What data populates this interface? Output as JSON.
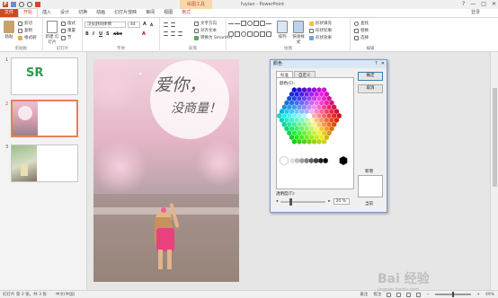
{
  "titlebar": {
    "app_icon": "P",
    "context_tools_label": "绘图工具",
    "window_title": "fuyian - PowerPoint",
    "controls": [
      "?",
      "—",
      "□",
      "✕"
    ]
  },
  "tabs": {
    "items": [
      "文件",
      "开始",
      "插入",
      "设计",
      "切换",
      "动画",
      "幻灯片放映",
      "审阅",
      "视图",
      "格式"
    ],
    "user": "登录"
  },
  "ribbon": {
    "paste_label": "粘贴",
    "cut_label": "剪切",
    "copy_label": "复制",
    "format_painter_label": "格式刷",
    "new_slide_label": "新建\n幻灯片",
    "layout_label": "版式",
    "reset_label": "重置",
    "section_label": "节",
    "font_name": "汉仪舒同体简",
    "font_size": "44",
    "text_direction_label": "文字方向",
    "align_text_label": "对齐文本",
    "smartart_label": "转换为 SmartArt",
    "arrange_label": "排列",
    "quick_styles_label": "快速样式",
    "shape_fill_label": "形状填充",
    "shape_outline_label": "形状轮廓",
    "shape_effects_label": "形状效果",
    "find_label": "查找",
    "replace_label": "替换",
    "select_label": "选择",
    "groups": [
      "剪贴板",
      "幻灯片",
      "字体",
      "段落",
      "绘图",
      "编辑"
    ]
  },
  "thumbnails": [
    {
      "number": "1",
      "logo_text": "SR"
    },
    {
      "number": "2",
      "caption": "爱你，没商量！"
    },
    {
      "number": "3"
    }
  ],
  "slide": {
    "title_line1": "爱你，",
    "title_line2": "没商量！"
  },
  "dialog": {
    "title": "颜色",
    "tabs": [
      "标准",
      "自定义"
    ],
    "colors_label": "颜色(C):",
    "ok_label": "确定",
    "cancel_label": "取消",
    "new_label": "新增",
    "current_label": "当前",
    "transparency_label": "透明度(T):",
    "transparency_value": "20 %",
    "transparency_fraction": 0.2
  },
  "statusbar": {
    "slide_info": "幻灯片 第 2 张，共 3 张",
    "language": "中文(中国)",
    "notes_label": "备注",
    "comments_label": "批注",
    "zoom": "49%"
  },
  "watermark": {
    "text": "Bai 经验",
    "sub": "jingyan.baidu.com"
  },
  "colors": {
    "accent": "#d24726",
    "selection": "#e8805c"
  }
}
